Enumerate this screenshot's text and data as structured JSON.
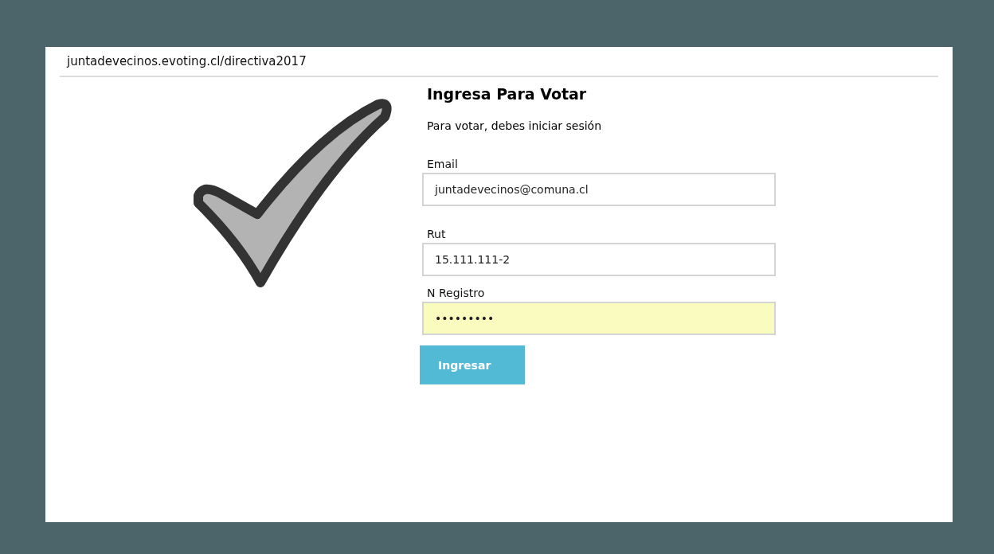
{
  "address_bar": {
    "url": "juntadevecinos.evoting.cl/directiva2017"
  },
  "form": {
    "title": "Ingresa Para Votar",
    "subtitle": "Para votar, debes iniciar sesión",
    "fields": [
      {
        "label": "Email",
        "value": "juntadevecinos@comuna.cl",
        "autofilled": false
      },
      {
        "label": "Rut",
        "value": "15.111.111-2",
        "autofilled": false
      },
      {
        "label": "N Registro",
        "value": "•••••••••",
        "autofilled": true
      }
    ],
    "submit": "Ingresar"
  }
}
